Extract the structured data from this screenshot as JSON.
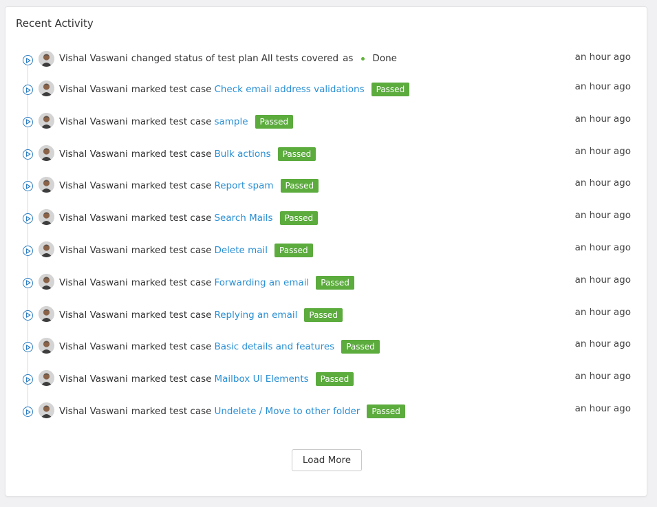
{
  "card": {
    "title": "Recent Activity"
  },
  "activity": {
    "first": {
      "user": "Vishal Vaswani",
      "action": "changed status of test plan",
      "plan_name": "All tests covered",
      "connector": "as",
      "status": "Done",
      "time": "an hour ago"
    },
    "items": [
      {
        "user": "Vishal Vaswani",
        "action": "marked test case",
        "test_case": "Check email address validations",
        "result": "Passed",
        "time": "an hour ago"
      },
      {
        "user": "Vishal Vaswani",
        "action": "marked test case",
        "test_case": "sample",
        "result": "Passed",
        "time": "an hour ago"
      },
      {
        "user": "Vishal Vaswani",
        "action": "marked test case",
        "test_case": "Bulk actions",
        "result": "Passed",
        "time": "an hour ago"
      },
      {
        "user": "Vishal Vaswani",
        "action": "marked test case",
        "test_case": "Report spam",
        "result": "Passed",
        "time": "an hour ago"
      },
      {
        "user": "Vishal Vaswani",
        "action": "marked test case",
        "test_case": "Search Mails",
        "result": "Passed",
        "time": "an hour ago"
      },
      {
        "user": "Vishal Vaswani",
        "action": "marked test case",
        "test_case": "Delete mail",
        "result": "Passed",
        "time": "an hour ago"
      },
      {
        "user": "Vishal Vaswani",
        "action": "marked test case",
        "test_case": "Forwarding an email",
        "result": "Passed",
        "time": "an hour ago"
      },
      {
        "user": "Vishal Vaswani",
        "action": "marked test case",
        "test_case": "Replying an email",
        "result": "Passed",
        "time": "an hour ago"
      },
      {
        "user": "Vishal Vaswani",
        "action": "marked test case",
        "test_case": "Basic details and features",
        "result": "Passed",
        "time": "an hour ago"
      },
      {
        "user": "Vishal Vaswani",
        "action": "marked test case",
        "test_case": "Mailbox UI Elements",
        "result": "Passed",
        "time": "an hour ago"
      },
      {
        "user": "Vishal Vaswani",
        "action": "marked test case",
        "test_case": "Undelete / Move to other folder",
        "result": "Passed",
        "time": "an hour ago"
      }
    ]
  },
  "load_more_label": "Load More",
  "colors": {
    "link": "#2a8fd3",
    "badge_passed": "#5bab3d",
    "status_done_dot": "#61b33b",
    "timeline_icon": "#2f7ec1"
  },
  "icons": {
    "timeline": "play-circle-icon",
    "avatar": "user-avatar"
  }
}
